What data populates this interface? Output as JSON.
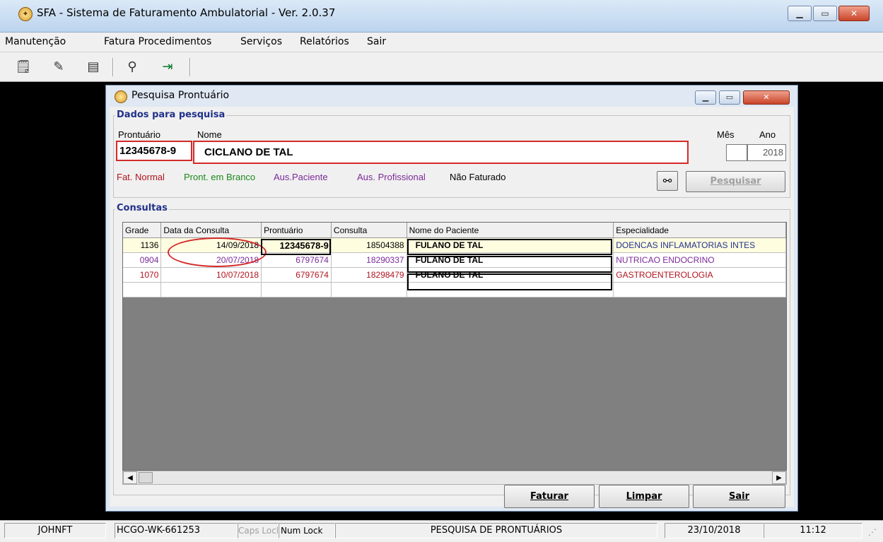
{
  "app": {
    "title": "SFA - Sistema de Faturamento Ambulatorial - Ver. 2.0.37",
    "icon": "app-icon",
    "window_controls": [
      "minimize-icon",
      "maximize-icon",
      "close-icon"
    ]
  },
  "menu": {
    "items": [
      {
        "label": "Manutenção"
      },
      {
        "label": "Fatura Procedimentos"
      },
      {
        "label": "Serviços"
      },
      {
        "label": "Relatórios"
      },
      {
        "label": "Sair"
      }
    ]
  },
  "toolbar": {
    "buttons": [
      {
        "icon": "form-icon"
      },
      {
        "icon": "edit-icon"
      },
      {
        "icon": "document-icon"
      },
      {
        "icon": "search-icon"
      },
      {
        "icon": "exit-icon"
      }
    ]
  },
  "dialog": {
    "title": "Pesquisa Prontuário",
    "search_group": {
      "legend": "Dados para pesquisa",
      "prontuario_label": "Prontuário",
      "nome_label": "Nome",
      "mes_label": "Mês",
      "ano_label": "Ano",
      "prontuario_value": "12345678-9",
      "nome_value": "CICLANO DE TAL",
      "mes_value": "",
      "ano_value": "2018",
      "legend_items": [
        {
          "label": "Fat. Normal",
          "color": "#b0141e"
        },
        {
          "label": "Pront. em Branco",
          "color": "#1a8a1a"
        },
        {
          "label": "Aus.Paciente",
          "color": "#7b2a9a"
        },
        {
          "label": "Aus. Profissional",
          "color": "#7b2a9a"
        },
        {
          "label": "Não Faturado",
          "color": "#000000"
        }
      ],
      "binoculars_icon": "binoculars-icon",
      "search_button": "Pesquisar"
    },
    "consultas": {
      "legend": "Consultas",
      "columns": [
        "Grade",
        "Data da Consulta",
        "Prontuário",
        "Consulta",
        "Nome do Paciente",
        "Especialidade"
      ],
      "rows": [
        {
          "grade": "1136",
          "data": "14/09/2018",
          "prontuario": "12345678-9",
          "consulta": "18504388",
          "nome": "FULANO DE TAL",
          "especialidade": "DOENCAS INFLAMATORIAS INTES",
          "color": "#000000"
        },
        {
          "grade": "0904",
          "data": "20/07/2018",
          "prontuario": "6797674",
          "consulta": "18290337",
          "nome": "FULANO DE TAL",
          "especialidade": "NUTRICAO ENDOCRINO",
          "color": "#7b2a9a"
        },
        {
          "grade": "1070",
          "data": "10/07/2018",
          "prontuario": "6797674",
          "consulta": "18298479",
          "nome": "FULANO DE TAL",
          "especialidade": "GASTROENTEROLOGIA",
          "color": "#b0141e"
        }
      ]
    },
    "buttons": {
      "faturar": "Faturar",
      "limpar": "Limpar",
      "sair": "Sair"
    }
  },
  "status": {
    "user": "JOHNFT",
    "host": "HCGO-WK-661253",
    "caps": "Caps Lock",
    "num": "Num Lock",
    "screen": "PESQUISA DE PRONTUÁRIOS",
    "date": "23/10/2018",
    "time": "11:12"
  }
}
